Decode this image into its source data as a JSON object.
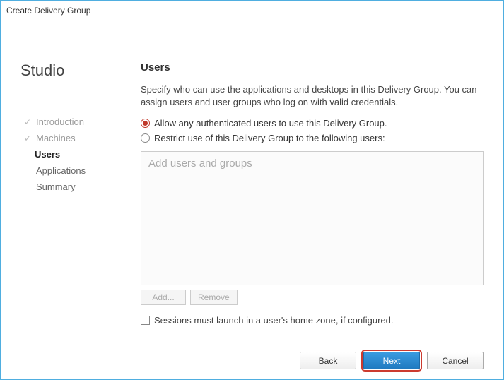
{
  "window": {
    "title": "Create Delivery Group"
  },
  "sidebar": {
    "brand": "Studio",
    "steps": [
      {
        "label": "Introduction",
        "state": "done"
      },
      {
        "label": "Machines",
        "state": "done"
      },
      {
        "label": "Users",
        "state": "current"
      },
      {
        "label": "Applications",
        "state": "pending"
      },
      {
        "label": "Summary",
        "state": "pending"
      }
    ]
  },
  "main": {
    "title": "Users",
    "description": "Specify who can use the applications and desktops in this Delivery Group. You can assign users and user groups who log on with valid credentials.",
    "radios": {
      "allow_any": "Allow any authenticated users to use this Delivery Group.",
      "restrict": "Restrict use of this Delivery Group to the following users:"
    },
    "listbox_placeholder": "Add users and groups",
    "add_button": "Add...",
    "remove_button": "Remove",
    "checkbox_label": "Sessions must launch in a user's home zone, if configured."
  },
  "footer": {
    "back": "Back",
    "next": "Next",
    "cancel": "Cancel"
  }
}
